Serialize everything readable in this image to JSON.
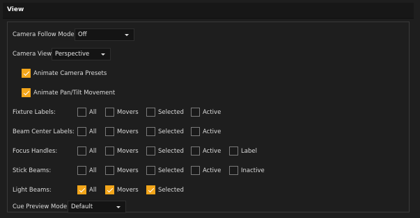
{
  "panel": {
    "title": "View"
  },
  "camera_follow_mode": {
    "label": "Camera Follow Mode",
    "value": "Off"
  },
  "camera_view": {
    "label": "Camera View",
    "value": "Perspective"
  },
  "animate_camera_presets": {
    "label": "Animate Camera Presets",
    "checked": true
  },
  "animate_pan_tilt": {
    "label": "Animate Pan/Tilt Movement",
    "checked": true
  },
  "options": {
    "all": "All",
    "movers": "Movers",
    "selected": "Selected",
    "active": "Active",
    "label": "Label",
    "inactive": "Inactive"
  },
  "fixture_labels": {
    "label": "Fixture Labels:",
    "checked": [
      false,
      false,
      false,
      false
    ]
  },
  "beam_center_labels": {
    "label": "Beam Center Labels:",
    "checked": [
      false,
      false,
      false,
      false
    ]
  },
  "focus_handles": {
    "label": "Focus Handles:",
    "checked": [
      false,
      false,
      false,
      false,
      false
    ]
  },
  "stick_beams": {
    "label": "Stick Beams:",
    "checked": [
      false,
      false,
      false,
      false,
      false
    ]
  },
  "light_beams": {
    "label": "Light Beams:",
    "checked": [
      true,
      true,
      true
    ]
  },
  "cue_preview_mode": {
    "label": "Cue Preview Mode",
    "value": "Default"
  },
  "colors": {
    "accent": "#f2a51a",
    "background": "#1e1e1e",
    "field": "#141414"
  }
}
